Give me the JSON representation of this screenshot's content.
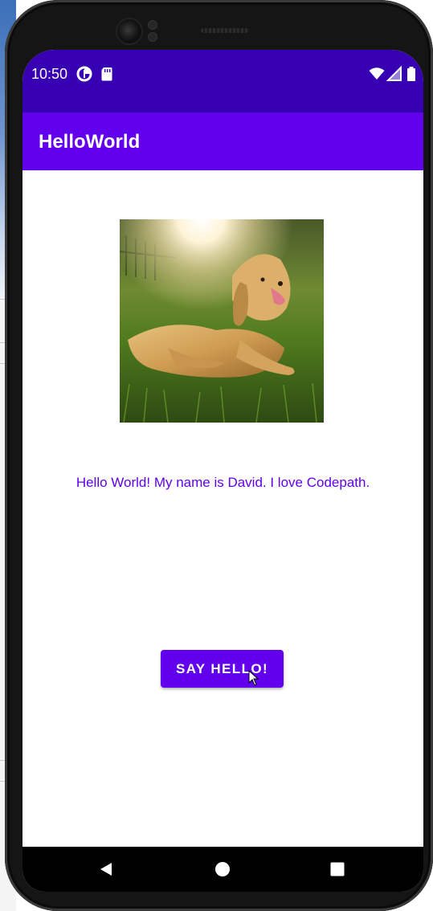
{
  "status_bar": {
    "time": "10:50",
    "background": "#3700b3",
    "icons": [
      "data-saver-icon",
      "sd-card-icon",
      "wifi-icon",
      "cell-signal-icon",
      "battery-icon"
    ]
  },
  "app_bar": {
    "title": "HelloWorld",
    "background": "#6200ee"
  },
  "main": {
    "image": {
      "description_icon": "golden-retriever-photo"
    },
    "greeting_text": "Hello World! My name is David. I love Codepath.",
    "say_hello_button": "SAY HELLO!",
    "accent_color": "#6200ee"
  },
  "nav_bar": {
    "buttons": [
      "back-icon",
      "home-icon",
      "recents-icon"
    ]
  }
}
